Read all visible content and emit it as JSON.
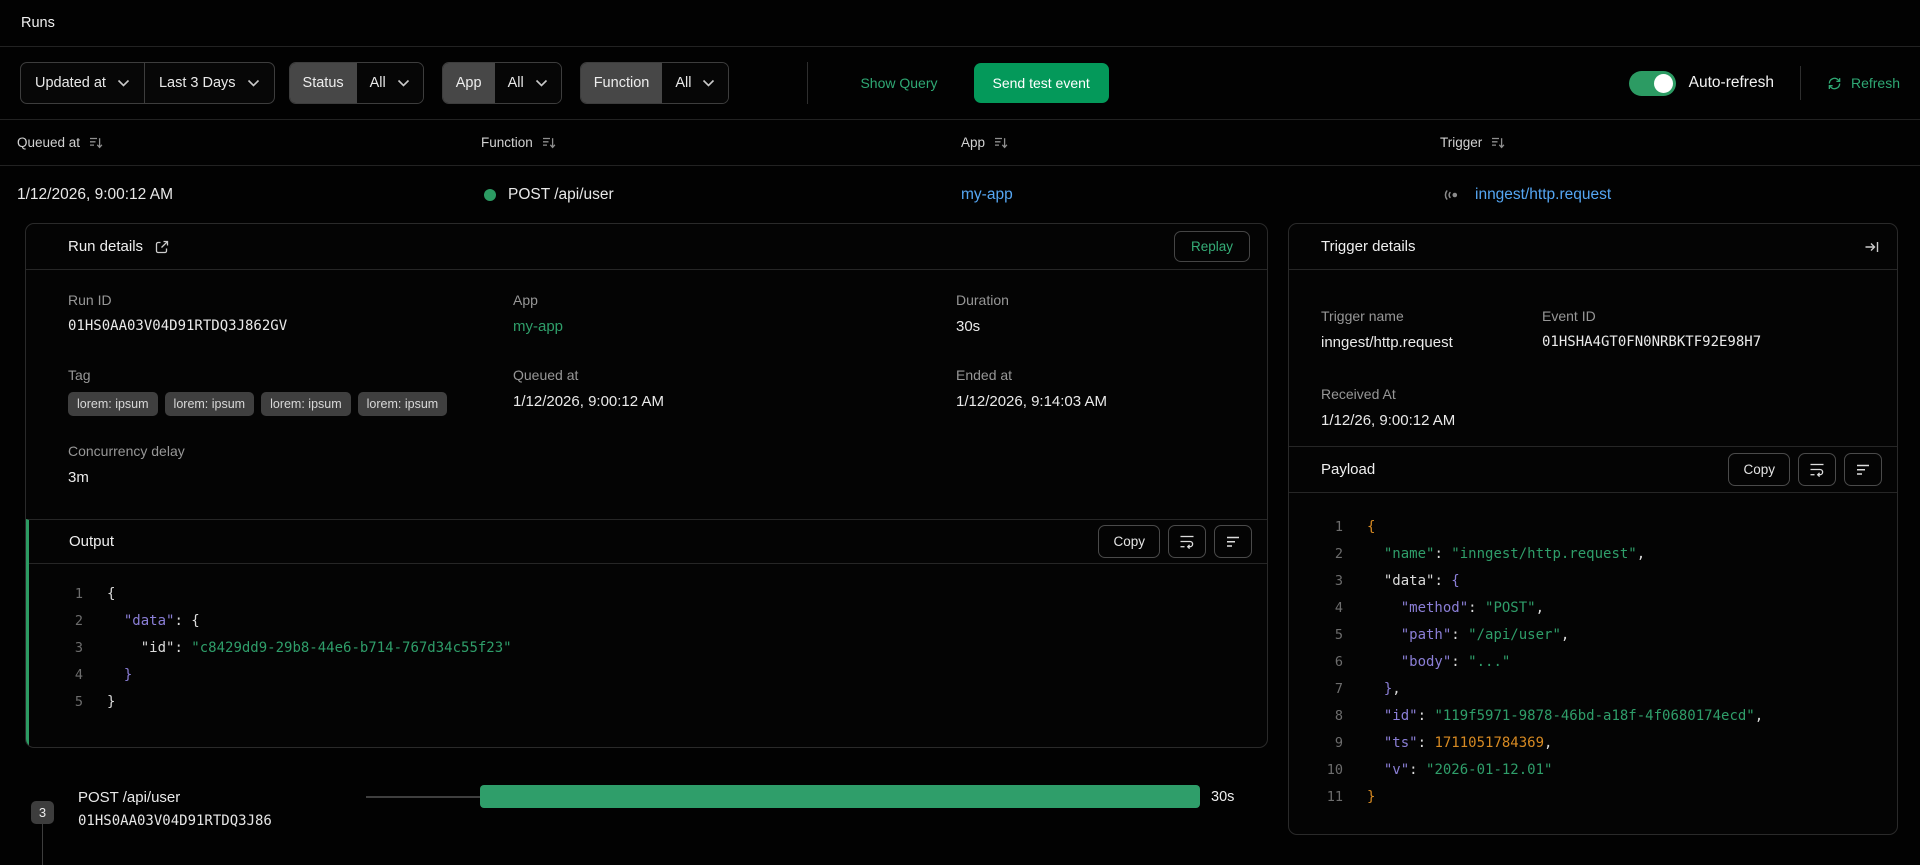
{
  "colors": {
    "accent_green": "#2c9b63",
    "button_green": "#04995a",
    "link_blue": "#55a6f3",
    "bar_green": "#2f9e6a",
    "code_purple": "#8b7fd7",
    "code_orange": "#d78a22"
  },
  "topbar": {
    "title": "Runs"
  },
  "toolbar": {
    "sort_select": "Updated at",
    "range_select": "Last 3 Days",
    "status": {
      "label": "Status",
      "value": "All"
    },
    "app": {
      "label": "App",
      "value": "All"
    },
    "function": {
      "label": "Function",
      "value": "All"
    },
    "show_query": "Show Query",
    "send_test_event": "Send test event",
    "auto_refresh": "Auto-refresh",
    "refresh": "Refresh"
  },
  "table": {
    "columns": [
      "Queued at",
      "Function",
      "App",
      "Trigger"
    ],
    "row": {
      "queued_at": "1/12/2026, 9:00:12 AM",
      "function": "POST /api/user",
      "app": "my-app",
      "trigger": "inngest/http.request"
    }
  },
  "run_details": {
    "title": "Run details",
    "replay_label": "Replay",
    "run_id_label": "Run ID",
    "run_id": "01HS0AA03V04D91RTDQ3J862GV",
    "app_label": "App",
    "app": "my-app",
    "duration_label": "Duration",
    "duration": "30s",
    "tag_label": "Tag",
    "tags": [
      "lorem: ipsum",
      "lorem: ipsum",
      "lorem: ipsum",
      "lorem: ipsum"
    ],
    "queued_at_label": "Queued at",
    "queued_at": "1/12/2026, 9:00:12 AM",
    "ended_at_label": "Ended at",
    "ended_at": "1/12/2026, 9:14:03 AM",
    "concurrency_label": "Concurrency delay",
    "concurrency": "3m",
    "output": {
      "title": "Output",
      "copy_label": "Copy",
      "lines": [
        {
          "n": "1",
          "seg": [
            [
              "{",
              "w"
            ]
          ]
        },
        {
          "n": "2",
          "seg": [
            [
              "  ",
              "w"
            ],
            [
              "\"data\"",
              "p"
            ],
            [
              ": ",
              "w"
            ],
            [
              "{",
              "w"
            ]
          ]
        },
        {
          "n": "3",
          "seg": [
            [
              "    ",
              "w"
            ],
            [
              "\"id\"",
              "w"
            ],
            [
              ": ",
              "w"
            ],
            [
              "\"c8429dd9-29b8-44e6-b714-767d34c55f23\"",
              "g"
            ]
          ]
        },
        {
          "n": "4",
          "seg": [
            [
              "  ",
              "w"
            ],
            [
              "}",
              "p"
            ]
          ]
        },
        {
          "n": "5",
          "seg": [
            [
              "}",
              "w"
            ]
          ]
        }
      ]
    }
  },
  "trigger_details": {
    "title": "Trigger details",
    "trigger_name_label": "Trigger name",
    "trigger_name": "inngest/http.request",
    "event_id_label": "Event ID",
    "event_id": "01HSHA4GT0FN0NRBKTF92E98H7",
    "received_at_label": "Received At",
    "received_at": "1/12/26, 9:00:12 AM",
    "payload": {
      "title": "Payload",
      "copy_label": "Copy",
      "lines": [
        {
          "n": "1",
          "seg": [
            [
              "{",
              "o"
            ]
          ]
        },
        {
          "n": "2",
          "seg": [
            [
              "  ",
              "w"
            ],
            [
              "\"name\"",
              "g"
            ],
            [
              ": ",
              "w"
            ],
            [
              "\"inngest/http.request\"",
              "g"
            ],
            [
              ",",
              "w"
            ]
          ]
        },
        {
          "n": "3",
          "seg": [
            [
              "  ",
              "w"
            ],
            [
              "\"data\"",
              "w"
            ],
            [
              ": ",
              "w"
            ],
            [
              "{",
              "p"
            ]
          ]
        },
        {
          "n": "4",
          "seg": [
            [
              "    ",
              "w"
            ],
            [
              "\"method\"",
              "p"
            ],
            [
              ": ",
              "w"
            ],
            [
              "\"POST\"",
              "g"
            ],
            [
              ",",
              "w"
            ]
          ]
        },
        {
          "n": "5",
          "seg": [
            [
              "    ",
              "w"
            ],
            [
              "\"path\"",
              "p"
            ],
            [
              ": ",
              "w"
            ],
            [
              "\"/api/user\"",
              "g"
            ],
            [
              ",",
              "w"
            ]
          ]
        },
        {
          "n": "6",
          "seg": [
            [
              "    ",
              "w"
            ],
            [
              "\"body\"",
              "p"
            ],
            [
              ": ",
              "w"
            ],
            [
              "\"...\"",
              "g"
            ]
          ]
        },
        {
          "n": "7",
          "seg": [
            [
              "  ",
              "w"
            ],
            [
              "}",
              "p"
            ],
            [
              ",",
              "w"
            ]
          ]
        },
        {
          "n": "8",
          "seg": [
            [
              "  ",
              "w"
            ],
            [
              "\"id\"",
              "p"
            ],
            [
              ": ",
              "w"
            ],
            [
              "\"119f5971-9878-46bd-a18f-4f0680174ecd\"",
              "g"
            ],
            [
              ",",
              "w"
            ]
          ]
        },
        {
          "n": "9",
          "seg": [
            [
              "  ",
              "w"
            ],
            [
              "\"ts\"",
              "p"
            ],
            [
              ": ",
              "w"
            ],
            [
              "1711051784369",
              "o"
            ],
            [
              ",",
              "w"
            ]
          ]
        },
        {
          "n": "10",
          "seg": [
            [
              "  ",
              "w"
            ],
            [
              "\"v\"",
              "p"
            ],
            [
              ": ",
              "w"
            ],
            [
              "\"2026-01-12.01\"",
              "g"
            ]
          ]
        },
        {
          "n": "11",
          "seg": [
            [
              "}",
              "o"
            ]
          ]
        }
      ]
    }
  },
  "timeline": {
    "step_count": "3",
    "function": "POST /api/user",
    "run_id": "01HS0AA03V04D91RTDQ3J86",
    "duration": "30s"
  }
}
